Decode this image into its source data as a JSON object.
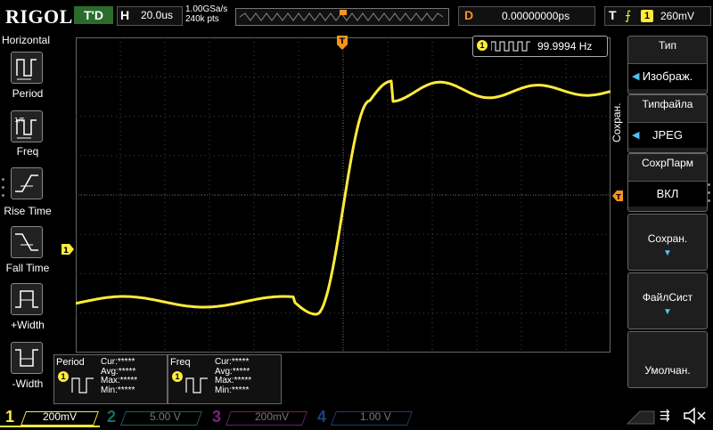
{
  "header": {
    "logo": "RIGOL",
    "trigger_status": "T'D",
    "horizontal_label": "H",
    "timebase": "20.0us",
    "sample_rate": "1.00GSa/s",
    "memory_depth": "240k pts",
    "delay_label": "D",
    "delay_value": "0.00000000ps",
    "trigger_label": "T",
    "trigger_channel": "1",
    "trigger_level": "260mV"
  },
  "left_menu": {
    "title": "Horizontal",
    "items": [
      {
        "label": "Period",
        "icon": "period-icon"
      },
      {
        "label": "Freq",
        "icon": "frequency-icon"
      },
      {
        "label": "Rise Time",
        "icon": "rise-time-icon"
      },
      {
        "label": "Fall Time",
        "icon": "fall-time-icon"
      },
      {
        "label": "+Width",
        "icon": "positive-width-icon"
      },
      {
        "label": "-Width",
        "icon": "negative-width-icon"
      }
    ]
  },
  "right_menu": {
    "side_title": "Сохран.",
    "items": [
      {
        "title": "Тип",
        "value": "Изображ."
      },
      {
        "title": "Типфайла",
        "value": "JPEG"
      },
      {
        "title": "СохрПарм",
        "value": "ВКЛ"
      },
      {
        "title": "Сохран.",
        "value": ""
      },
      {
        "title": "ФайлСист",
        "value": ""
      },
      {
        "title": "Умолчан.",
        "value": ""
      }
    ]
  },
  "freq_counter": {
    "channel": "1",
    "value": "99.9994 Hz"
  },
  "markers": {
    "trigger_position": "T",
    "channel1_ground": "1"
  },
  "measurements": [
    {
      "name": "Period",
      "channel": "1",
      "cur": "Cur:*****",
      "avg": "Avg:*****",
      "max": "Max:*****",
      "min": "Min:*****"
    },
    {
      "name": "Freq",
      "channel": "1",
      "cur": "Cur:*****",
      "avg": "Avg:*****",
      "max": "Max:*****",
      "min": "Min:*****"
    }
  ],
  "channels": [
    {
      "num": "1",
      "scale": "200mV",
      "color": "#ffeb3b"
    },
    {
      "num": "2",
      "scale": "5.00 V",
      "color": "#22b5b0"
    },
    {
      "num": "3",
      "scale": "200mV",
      "color": "#d63ad6"
    },
    {
      "num": "4",
      "scale": "1.00 V",
      "color": "#2f6fd6"
    }
  ],
  "colors": {
    "ch1": "#ffeb3b",
    "trigger_marker": "#f7941d",
    "grid": "#555555"
  }
}
